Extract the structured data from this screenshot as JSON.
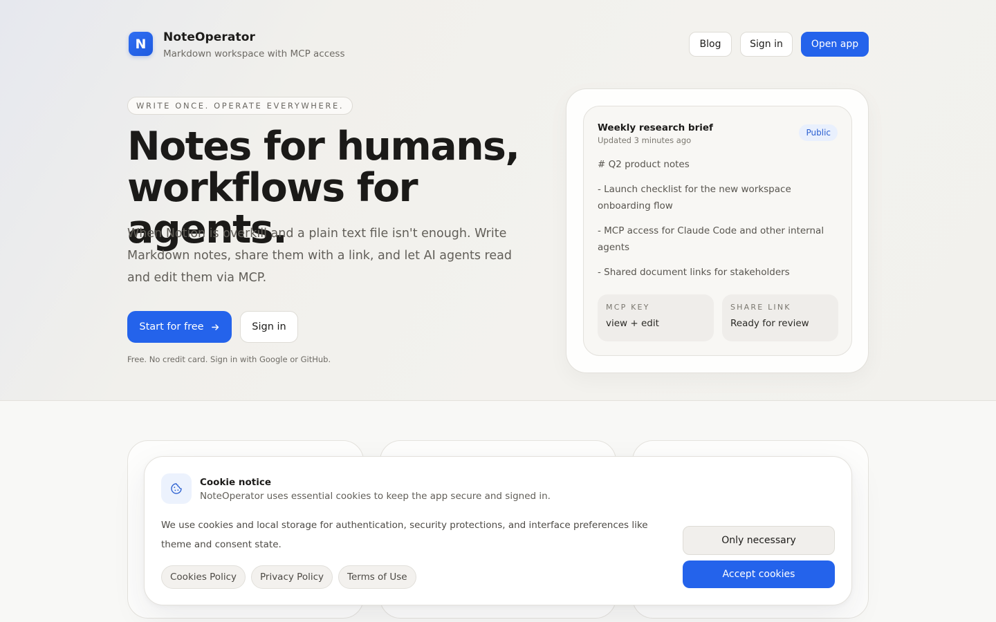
{
  "brand": {
    "logo_letter": "N",
    "name": "NoteOperator",
    "tagline": "Markdown workspace with MCP access"
  },
  "nav": {
    "blog": "Blog",
    "sign_in": "Sign in",
    "open_app": "Open app"
  },
  "hero": {
    "eyebrow": "WRITE ONCE. OPERATE EVERYWHERE.",
    "headline_line1": "Notes for humans,",
    "headline_line2": "workflows for agents.",
    "lead": "When Notion is overkill and a plain text file isn't enough. Write Markdown notes, share them with a link, and let AI agents read and edit them via MCP.",
    "cta_primary": "Start for free",
    "cta_secondary": "Sign in",
    "fineprint": "Free. No credit card. Sign in with Google or GitHub."
  },
  "preview": {
    "title": "Weekly research brief",
    "updated": "Updated 3 minutes ago",
    "badge": "Public",
    "lines": [
      "# Q2 product notes",
      "- Launch checklist for the new workspace onboarding flow",
      "- MCP access for Claude Code and other internal agents",
      "- Shared document links for stakeholders"
    ],
    "mcp_key_label": "MCP KEY",
    "mcp_key_value": "view + edit",
    "share_label": "SHARE LINK",
    "share_value": "Ready for review"
  },
  "cookie": {
    "title": "Cookie notice",
    "subtitle": "NoteOperator uses essential cookies to keep the app secure and signed in.",
    "body": "We use cookies and local storage for authentication, security protections, and interface preferences like theme and consent state.",
    "links": [
      "Cookies Policy",
      "Privacy Policy",
      "Terms of Use"
    ],
    "only_necessary": "Only necessary",
    "accept": "Accept cookies"
  },
  "colors": {
    "accent": "#2463eb",
    "badge_bg": "#e9f0fd",
    "text": "#1c1b19"
  },
  "icons": {
    "cta_arrow": "arrow-right-icon",
    "cookie": "cookie-icon"
  }
}
